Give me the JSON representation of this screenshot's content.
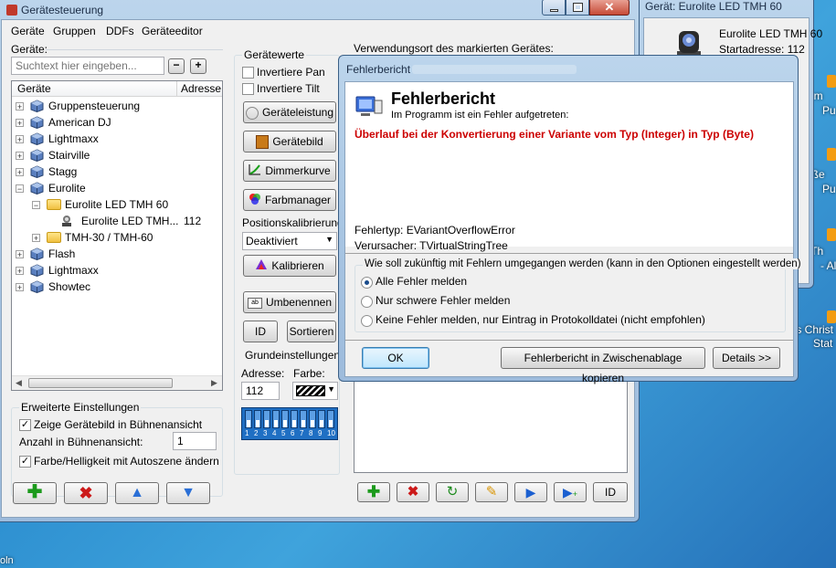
{
  "main_window": {
    "title": "Gerätesteuerung",
    "menu": [
      "Geräte",
      "Gruppen",
      "DDFs",
      "Geräteeditor"
    ],
    "devices_label": "Geräte:",
    "search_placeholder": "Suchtext hier eingeben...",
    "tree_headers": {
      "name": "Geräte",
      "address": "Adresse"
    },
    "tree": [
      {
        "label": "Gruppensteuerung",
        "level": 0,
        "expanded": false,
        "icon": "cube-icon"
      },
      {
        "label": "American DJ",
        "level": 0,
        "expanded": false,
        "icon": "cube-icon"
      },
      {
        "label": "Lightmaxx",
        "level": 0,
        "expanded": false,
        "icon": "cube-icon"
      },
      {
        "label": "Stairville",
        "level": 0,
        "expanded": false,
        "icon": "cube-icon"
      },
      {
        "label": "Stagg",
        "level": 0,
        "expanded": false,
        "icon": "cube-icon"
      },
      {
        "label": "Eurolite",
        "level": 0,
        "expanded": true,
        "icon": "cube-icon"
      },
      {
        "label": "Eurolite LED TMH 60",
        "level": 1,
        "expanded": true,
        "icon": "folder-icon"
      },
      {
        "label": "Eurolite LED TMH...",
        "level": 2,
        "address": "112",
        "icon": "moving-head-icon"
      },
      {
        "label": "TMH-30 / TMH-60",
        "level": 1,
        "expanded": false,
        "icon": "folder-icon"
      },
      {
        "label": "Flash",
        "level": 0,
        "expanded": false,
        "icon": "cube-icon"
      },
      {
        "label": "Lightmaxx",
        "level": 0,
        "expanded": false,
        "icon": "cube-icon"
      },
      {
        "label": "Showtec",
        "level": 0,
        "expanded": false,
        "icon": "cube-icon"
      }
    ],
    "extended": {
      "title": "Erweiterte Einstellungen",
      "show_image": "Zeige Gerätebild in Bühnenansicht",
      "count_label": "Anzahl in Bühnenansicht:",
      "count_value": "1",
      "color_autoscene": "Farbe/Helligkeit mit Autoszene ändern"
    },
    "values": {
      "title": "Gerätewerte",
      "invert_pan": "Invertiere Pan",
      "invert_tilt": "Invertiere Tilt",
      "power_btn": "Geräteleistung",
      "image_btn": "Gerätebild",
      "dimmer_btn": "Dimmerkurve",
      "color_btn": "Farbmanager",
      "pos_label": "Positionskalibrierung:",
      "pos_value": "Deaktiviert",
      "calibrate_btn": "Kalibrieren",
      "rename_btn": "Umbenennen",
      "id_btn": "ID",
      "sort_btn": "Sortieren"
    },
    "basic": {
      "title": "Grundeinstellungen",
      "address_label": "Adresse:",
      "address_value": "112",
      "color_label": "Farbe:",
      "dip_labels": [
        "1",
        "2",
        "3",
        "4",
        "5",
        "6",
        "7",
        "8",
        "9",
        "10"
      ]
    },
    "usage_label": "Verwendungsort des markierten Gerätes:",
    "bottom_id_btn": "ID"
  },
  "side_window": {
    "title": "Gerät: Eurolite LED TMH 60",
    "name": "Eurolite LED TMH 60",
    "start": "Startadresse: 112"
  },
  "dialog": {
    "title": "Fehlerbericht",
    "heading": "Fehlerbericht",
    "subheading": "Im Programm ist ein Fehler aufgetreten:",
    "error_message": "Überlauf bei der Konvertierung einer Variante vom Typ (Integer) in Typ (Byte)",
    "error_type": "Fehlertyp: EVariantOverflowError",
    "cause": "Verursacher: TVirtualStringTree",
    "group_label": "Wie soll zukünftig mit Fehlern umgegangen werden (kann in den Optionen eingestellt werden)",
    "options": [
      {
        "label": "Alle Fehler melden",
        "selected": true
      },
      {
        "label": "Nur schwere Fehler melden",
        "selected": false
      },
      {
        "label": "Keine Fehler melden, nur Eintrag in Protokolldatei (nicht empfohlen)",
        "selected": false
      }
    ],
    "ok_btn": "OK",
    "copy_btn": "Fehlerbericht in Zwischenablage kopieren",
    "details_btn": "Details >>",
    "error_color": "#cc0000"
  },
  "desktop_fragments": [
    "zem",
    "Pu",
    "roße",
    "Pu",
    "r Th",
    "- Al",
    "ts Christ",
    "Stat",
    "oln"
  ]
}
